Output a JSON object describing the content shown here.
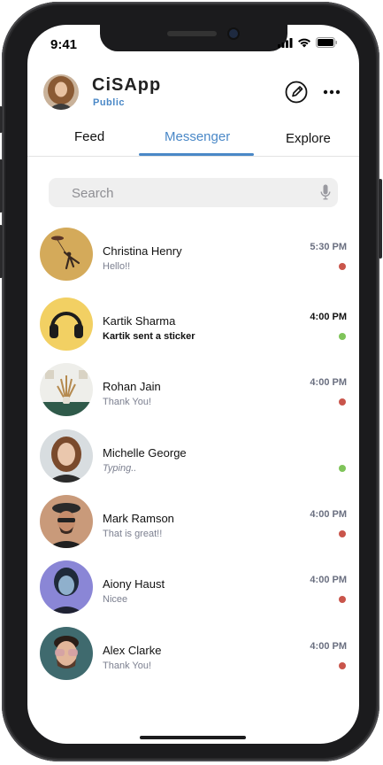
{
  "status": {
    "time": "9:41"
  },
  "header": {
    "app_name": "CiSApp",
    "app_sub": "Public",
    "compose_icon": "compose-icon",
    "more_icon": "more-icon"
  },
  "tabs": [
    {
      "label": "Feed"
    },
    {
      "label": "Messenger",
      "active": true
    },
    {
      "label": "Explore"
    }
  ],
  "search": {
    "placeholder": "Search",
    "icon": "microphone-icon"
  },
  "colors": {
    "accent": "#4a88c7",
    "unread": "#c9554b",
    "online": "#7fc45a"
  },
  "conversations": [
    {
      "name": "Christina Henry",
      "preview": "Hello!!",
      "time": "5:30 PM",
      "status": "unread"
    },
    {
      "name": "Kartik Sharma",
      "preview": "Kartik sent a sticker",
      "time": "4:00 PM",
      "status": "online"
    },
    {
      "name": "Rohan Jain",
      "preview": "Thank You!",
      "time": "4:00 PM",
      "status": "unread"
    },
    {
      "name": "Michelle George",
      "preview": "Typing..",
      "time": "",
      "status": "online"
    },
    {
      "name": "Mark Ramson",
      "preview": "That is great!!",
      "time": "4:00 PM",
      "status": "unread"
    },
    {
      "name": "Aiony Haust",
      "preview": "Nicee",
      "time": "4:00 PM",
      "status": "unread"
    },
    {
      "name": "Alex Clarke",
      "preview": "Thank You!",
      "time": "4:00 PM",
      "status": "unread"
    }
  ]
}
